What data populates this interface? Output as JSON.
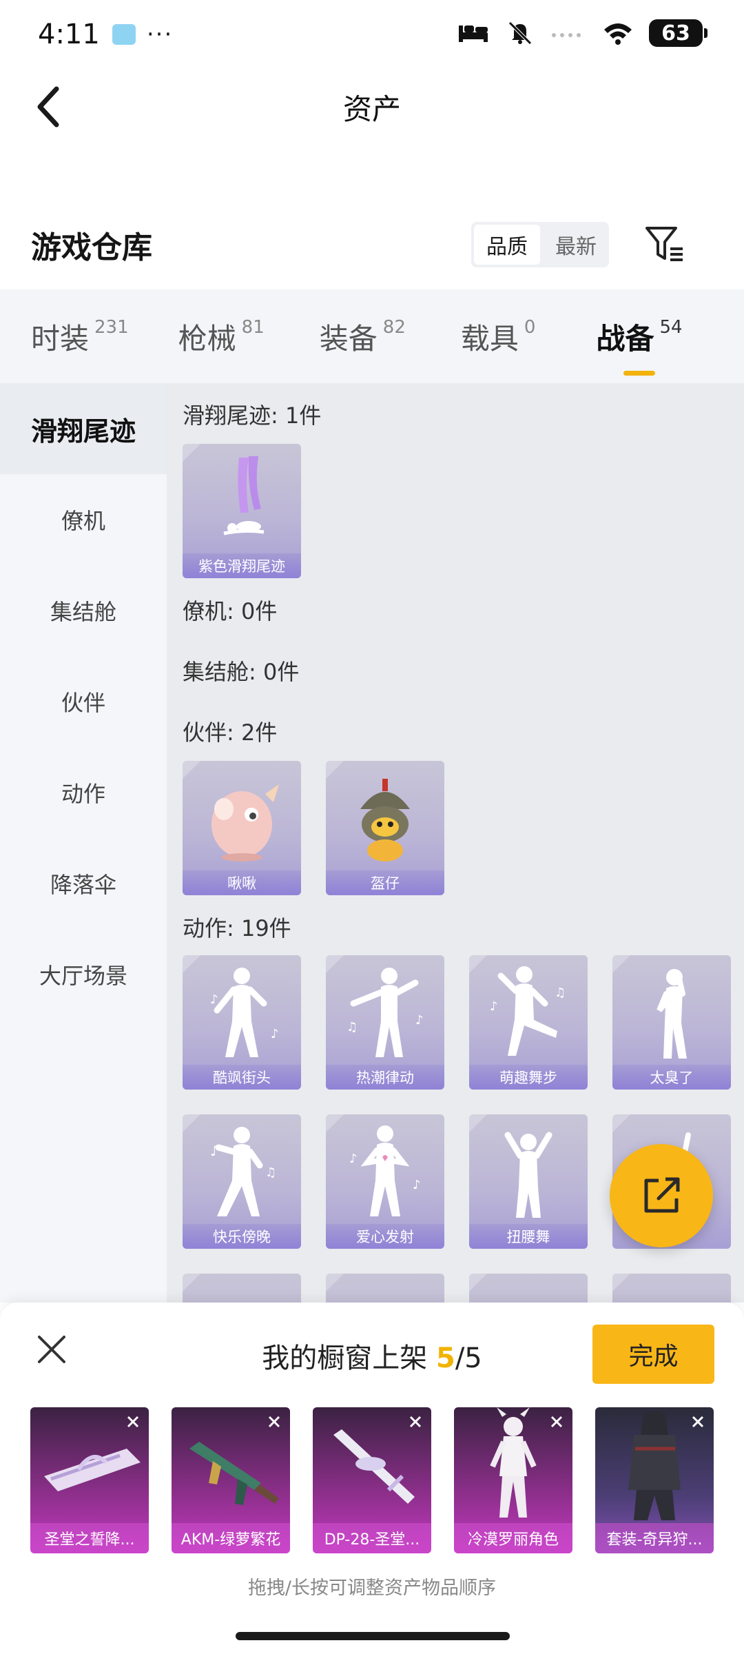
{
  "status_bar": {
    "time": "4:11",
    "dots": "···",
    "battery": "63"
  },
  "header": {
    "title": "资产"
  },
  "warehouse": {
    "title": "游戏仓库",
    "sort_options": [
      "品质",
      "最新"
    ]
  },
  "tabs": [
    {
      "label": "时装",
      "count": "231"
    },
    {
      "label": "枪械",
      "count": "81"
    },
    {
      "label": "装备",
      "count": "82"
    },
    {
      "label": "载具",
      "count": "0"
    },
    {
      "label": "战备",
      "count": "54"
    }
  ],
  "sidebar": {
    "items": [
      "滑翔尾迹",
      "僚机",
      "集结舱",
      "伙伴",
      "动作",
      "降落伞",
      "大厅场景"
    ]
  },
  "sections": {
    "glide_trail": {
      "title": "滑翔尾迹: 1件",
      "items": [
        "紫色滑翔尾迹"
      ]
    },
    "wingman": {
      "title": "僚机: 0件"
    },
    "rally_pod": {
      "title": "集结舱: 0件"
    },
    "partner": {
      "title": "伙伴: 2件",
      "items": [
        "啾啾",
        "盔仔"
      ]
    },
    "action": {
      "title": "动作: 19件",
      "items": [
        "酷飒街头",
        "热潮律动",
        "萌趣舞步",
        "太臭了",
        "快乐傍晚",
        "爱心发射",
        "扭腰舞"
      ]
    }
  },
  "panel": {
    "title": "我的橱窗上架",
    "count_current": "5",
    "count_total": "/5",
    "done_label": "完成",
    "items": [
      "圣堂之誓降...",
      "AKM-绿萝繁花",
      "DP-28-圣堂...",
      "冷漠罗丽角色",
      "套装-奇异狩..."
    ],
    "hint": "拖拽/长按可调整资产物品顺序"
  }
}
